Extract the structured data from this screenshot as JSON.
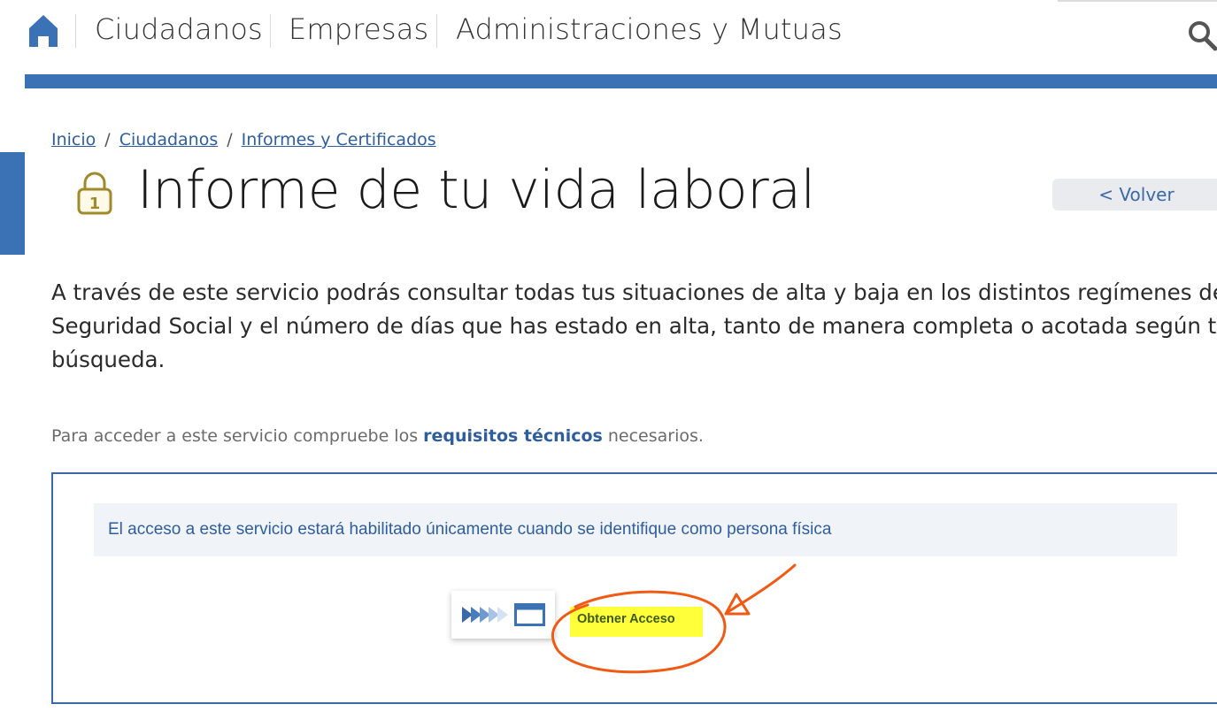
{
  "nav": {
    "items": [
      "Ciudadanos",
      "Empresas",
      "Administraciones y Mutuas"
    ]
  },
  "breadcrumb": {
    "items": [
      "Inicio",
      "Ciudadanos",
      "Informes y Certificados"
    ],
    "separator": "/"
  },
  "page": {
    "title": "Informe de tu vida laboral",
    "back_label": "< Volver",
    "description_lines": [
      "A través de este servicio podrás consultar todas tus situaciones de alta y baja en los distintos regímenes de la",
      "Seguridad Social y el número de días que has estado en alta, tanto de manera completa o acotada según tu",
      "búsqueda."
    ],
    "requirements": {
      "prefix": "Para acceder a este servicio compruebe los ",
      "link": "requisitos técnicos",
      "suffix": " necesarios."
    }
  },
  "access": {
    "notice": "El acceso a este servicio estará habilitado únicamente cuando se identifique como persona física",
    "button_label": "Obtener Acceso"
  },
  "colors": {
    "brand_blue": "#3b72b5",
    "link_blue": "#2e5e9e",
    "highlight_yellow": "#ffff3a",
    "annotation_orange": "#f05a14",
    "lock_gold": "#a08a2a"
  },
  "icons": {
    "home": "home-icon",
    "search": "search-icon",
    "lock": "lock-icon",
    "arrows": "forward-arrows-icon",
    "window": "window-icon"
  }
}
